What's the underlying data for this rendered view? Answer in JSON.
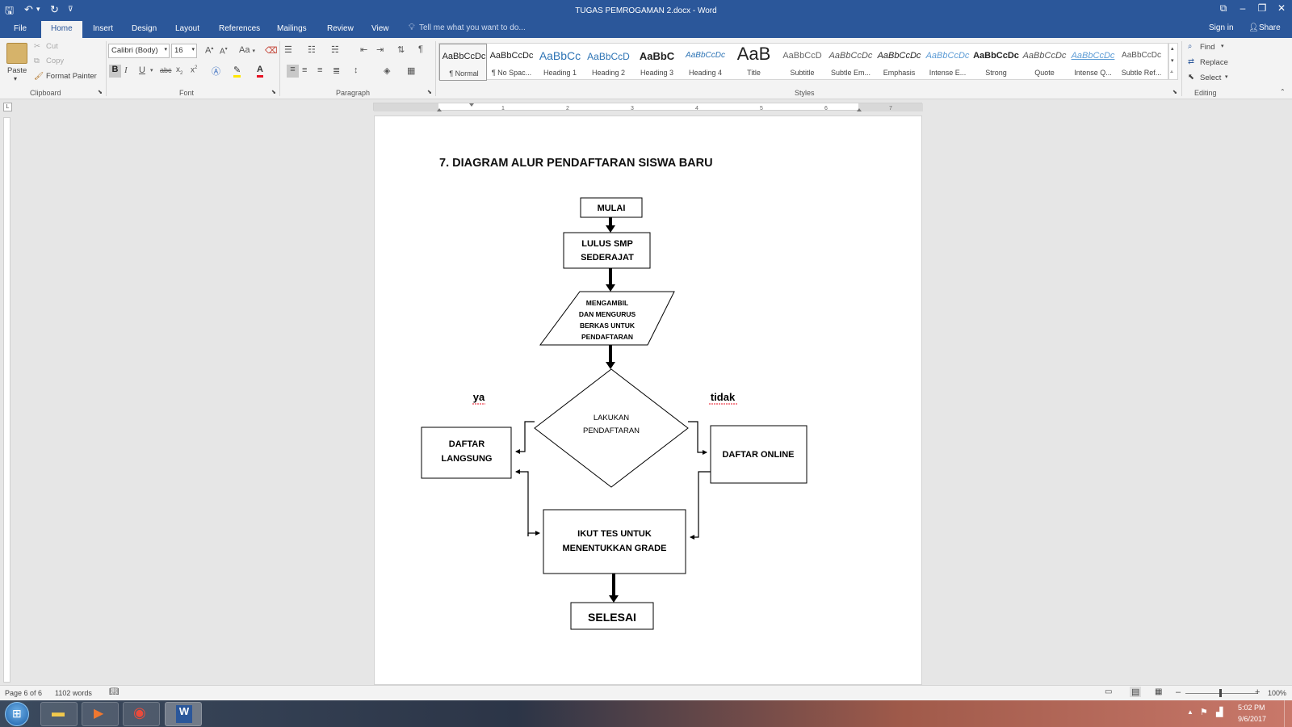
{
  "window": {
    "title": "TUGAS PEMROGAMAN 2.docx - Word"
  },
  "tabs": [
    "File",
    "Home",
    "Insert",
    "Design",
    "Layout",
    "References",
    "Mailings",
    "Review",
    "View"
  ],
  "tell_me": "Tell me what you want to do...",
  "account": {
    "signin": "Sign in",
    "share": "Share"
  },
  "clipboard": {
    "paste": "Paste",
    "cut": "Cut",
    "copy": "Copy",
    "format_painter": "Format Painter",
    "label": "Clipboard"
  },
  "font": {
    "name": "Calibri (Body)",
    "size": "16",
    "label": "Font",
    "case": "Aa"
  },
  "paragraph": {
    "label": "Paragraph"
  },
  "styles": {
    "label": "Styles",
    "items": [
      {
        "preview": "AaBbCcDc",
        "name": "¶ Normal"
      },
      {
        "preview": "AaBbCcDc",
        "name": "¶ No Spac..."
      },
      {
        "preview": "AaBbCc",
        "name": "Heading 1"
      },
      {
        "preview": "AaBbCcD",
        "name": "Heading 2"
      },
      {
        "preview": "AaBbC",
        "name": "Heading 3"
      },
      {
        "preview": "AaBbCcDc",
        "name": "Heading 4"
      },
      {
        "preview": "AaB",
        "name": "Title"
      },
      {
        "preview": "AaBbCcD",
        "name": "Subtitle"
      },
      {
        "preview": "AaBbCcDc",
        "name": "Subtle Em..."
      },
      {
        "preview": "AaBbCcDc",
        "name": "Emphasis"
      },
      {
        "preview": "AaBbCcDc",
        "name": "Intense E..."
      },
      {
        "preview": "AaBbCcDc",
        "name": "Strong"
      },
      {
        "preview": "AaBbCcDc",
        "name": "Quote"
      },
      {
        "preview": "AaBbCcDc",
        "name": "Intense Q..."
      },
      {
        "preview": "AaBbCcDc",
        "name": "Subtle Ref..."
      }
    ]
  },
  "editing": {
    "find": "Find",
    "replace": "Replace",
    "select": "Select",
    "label": "Editing"
  },
  "document": {
    "heading": "7. DIAGRAM ALUR PENDAFTARAN SISWA BARU",
    "flow": {
      "start": "MULAI",
      "step1": [
        "LULUS SMP",
        "SEDERAJAT"
      ],
      "step2": [
        "MENGAMBIL",
        "DAN MENGURUS",
        "BERKAS UNTUK",
        "PENDAFTARAN"
      ],
      "decision": [
        "LAKUKAN",
        "PENDAFTARAN"
      ],
      "yes_label": "ya",
      "no_label": "tidak",
      "yes_branch": [
        "DAFTAR",
        "LANGSUNG"
      ],
      "no_branch": "DAFTAR ONLINE",
      "test": [
        "IKUT TES UNTUK",
        "MENENTUKKAN GRADE"
      ],
      "end": "SELESAI"
    }
  },
  "status": {
    "page": "Page 6 of 6",
    "words": "1102 words",
    "zoom": "100%"
  },
  "taskbar": {
    "time": "5:02 PM",
    "date": "9/6/2017"
  }
}
